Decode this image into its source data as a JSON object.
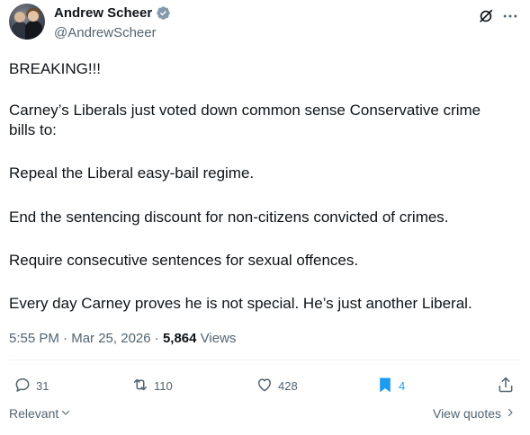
{
  "author": {
    "name": "Andrew Scheer",
    "handle": "@AndrewScheer",
    "verified_color": "#829aab"
  },
  "tweet": {
    "paragraphs": [
      "BREAKING!!!",
      "Carney’s Liberals just voted down common sense Conservative crime bills to:",
      "Repeal the Liberal easy-bail regime.",
      "End the sentencing discount for non-citizens convicted of crimes.",
      "Require consecutive sentences for sexual offences.",
      "Every day Carney proves he is not special. He’s just another Liberal."
    ],
    "time": "5:55 PM",
    "date": "Mar 25, 2026",
    "views_count": "5,864",
    "views_label": "Views"
  },
  "actions": {
    "replies": "31",
    "reposts": "110",
    "likes": "428",
    "bookmarks": "4"
  },
  "footer": {
    "sort_label": "Relevant",
    "quotes_label": "View quotes"
  },
  "colors": {
    "text": "#0f1419",
    "secondary": "#536471",
    "accent": "#1d9bf0"
  },
  "icons": [
    "verified-badge-icon",
    "grok-icon",
    "more-icon",
    "reply-icon",
    "repost-icon",
    "like-icon",
    "bookmark-icon",
    "share-icon",
    "chevron-down-icon",
    "chevron-right-icon"
  ]
}
